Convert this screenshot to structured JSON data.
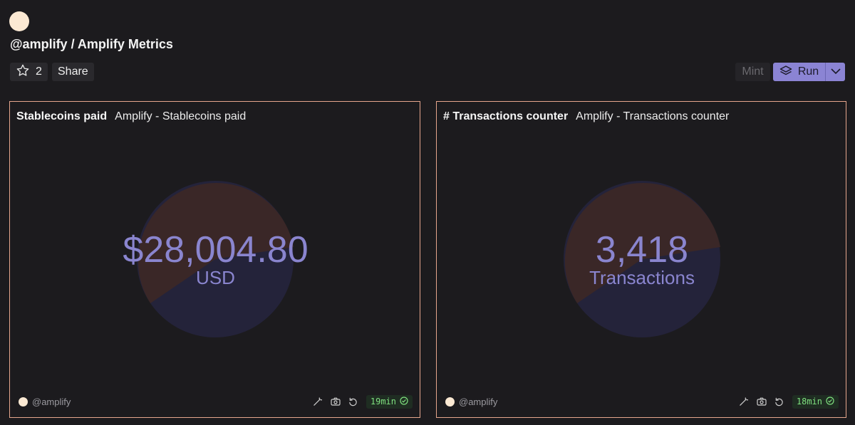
{
  "header": {
    "title": "@amplify / Amplify Metrics",
    "star_count": "2",
    "share_label": "Share",
    "mint_label": "Mint",
    "run_label": "Run"
  },
  "panels": [
    {
      "name": "Stablecoins paid",
      "query": "Amplify - Stablecoins paid",
      "value": "$28,004.80",
      "unit": "USD",
      "author": "@amplify",
      "age": "19min"
    },
    {
      "name": "# Transactions counter",
      "query": "Amplify - Transactions counter",
      "value": "3,418",
      "unit": "Transactions",
      "author": "@amplify",
      "age": "18min"
    }
  ],
  "colors": {
    "accent": "#8b84d4",
    "panel_border": "#e6a68d",
    "pie_a": "#3a2727",
    "pie_b": "#24233a",
    "fresh": "#7fe07f"
  }
}
